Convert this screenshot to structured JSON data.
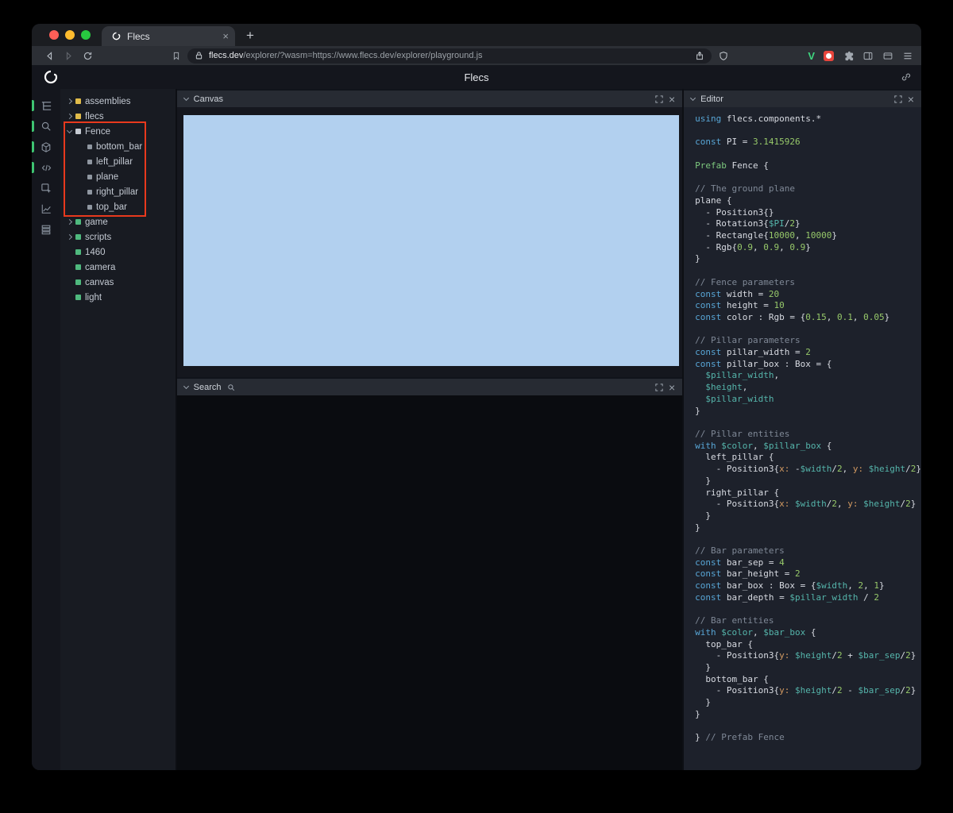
{
  "browser": {
    "tab_title": "Flecs",
    "close_tab_label": "×",
    "new_tab_label": "+",
    "url_host": "flecs.dev",
    "url_path": "/explorer/?wasm=https://www.flecs.dev/explorer/playground.js",
    "traffic_lights": [
      "#ff5f57",
      "#febc2e",
      "#28c840"
    ],
    "extension_v_label": "V"
  },
  "header": {
    "title": "Flecs"
  },
  "sidebar_icons": [
    {
      "name": "entity-tree",
      "active": true
    },
    {
      "name": "search",
      "active": true
    },
    {
      "name": "entities",
      "active": true
    },
    {
      "name": "code",
      "active": true
    },
    {
      "name": "inspector",
      "active": false
    },
    {
      "name": "stats",
      "active": false
    },
    {
      "name": "queries",
      "active": false
    }
  ],
  "tree": {
    "items": [
      {
        "label": "assemblies",
        "chevron": "collapsed",
        "square": "#e0bb4a",
        "depth": 0
      },
      {
        "label": "flecs",
        "chevron": "collapsed",
        "square": "#e0bb4a",
        "depth": 0
      },
      {
        "label": "Fence",
        "chevron": "expanded",
        "square": "#c6cbd3",
        "depth": 0
      },
      {
        "label": "bottom_bar",
        "chevron": "none",
        "square": "#8f97a1",
        "depth": 1
      },
      {
        "label": "left_pillar",
        "chevron": "none",
        "square": "#8f97a1",
        "depth": 1
      },
      {
        "label": "plane",
        "chevron": "none",
        "square": "#8f97a1",
        "depth": 1
      },
      {
        "label": "right_pillar",
        "chevron": "none",
        "square": "#8f97a1",
        "depth": 1
      },
      {
        "label": "top_bar",
        "chevron": "none",
        "square": "#8f97a1",
        "depth": 1
      },
      {
        "label": "game",
        "chevron": "collapsed",
        "square": "#4fb97e",
        "depth": 0
      },
      {
        "label": "scripts",
        "chevron": "collapsed",
        "square": "#4fb97e",
        "depth": 0
      },
      {
        "label": "1460",
        "chevron": "none",
        "square": "#4fb97e",
        "depth": 0
      },
      {
        "label": "camera",
        "chevron": "none",
        "square": "#4fb97e",
        "depth": 0
      },
      {
        "label": "canvas",
        "chevron": "none",
        "square": "#4fb97e",
        "depth": 0
      },
      {
        "label": "light",
        "chevron": "none",
        "square": "#4fb97e",
        "depth": 0
      }
    ],
    "annotation_color": "#e8391d"
  },
  "panels": {
    "canvas": {
      "title": "Canvas",
      "canvas_color": "#b2d0ef"
    },
    "search": {
      "title": "Search"
    },
    "editor": {
      "title": "Editor"
    }
  },
  "code": {
    "lines": [
      [
        [
          "k",
          "using"
        ],
        [
          "p",
          " flecs.components.*"
        ]
      ],
      [],
      [
        [
          "k",
          "const"
        ],
        [
          "p",
          " PI = "
        ],
        [
          "n",
          "3.1415926"
        ]
      ],
      [],
      [
        [
          "k2",
          "Prefab"
        ],
        [
          "p",
          " Fence {"
        ]
      ],
      [],
      [
        [
          "c",
          "// The ground plane"
        ]
      ],
      [
        [
          "p",
          "plane {"
        ]
      ],
      [
        [
          "p",
          "  - Position3{}"
        ]
      ],
      [
        [
          "p",
          "  - Rotation3{"
        ],
        [
          "v",
          "$PI"
        ],
        [
          "p",
          "/"
        ],
        [
          "n",
          "2"
        ],
        [
          "p",
          "}"
        ]
      ],
      [
        [
          "p",
          "  - Rectangle{"
        ],
        [
          "n",
          "10000"
        ],
        [
          "p",
          ", "
        ],
        [
          "n",
          "10000"
        ],
        [
          "p",
          "}"
        ]
      ],
      [
        [
          "p",
          "  - Rgb{"
        ],
        [
          "n",
          "0.9"
        ],
        [
          "p",
          ", "
        ],
        [
          "n",
          "0.9"
        ],
        [
          "p",
          ", "
        ],
        [
          "n",
          "0.9"
        ],
        [
          "p",
          "}"
        ]
      ],
      [
        [
          "p",
          "}"
        ]
      ],
      [],
      [
        [
          "c",
          "// Fence parameters"
        ]
      ],
      [
        [
          "k",
          "const"
        ],
        [
          "p",
          " width = "
        ],
        [
          "n",
          "20"
        ]
      ],
      [
        [
          "k",
          "const"
        ],
        [
          "p",
          " height = "
        ],
        [
          "n",
          "10"
        ]
      ],
      [
        [
          "k",
          "const"
        ],
        [
          "p",
          " color : Rgb = {"
        ],
        [
          "n",
          "0.15"
        ],
        [
          "p",
          ", "
        ],
        [
          "n",
          "0.1"
        ],
        [
          "p",
          ", "
        ],
        [
          "n",
          "0.05"
        ],
        [
          "p",
          "}"
        ]
      ],
      [],
      [
        [
          "c",
          "// Pillar parameters"
        ]
      ],
      [
        [
          "k",
          "const"
        ],
        [
          "p",
          " pillar_width = "
        ],
        [
          "n",
          "2"
        ]
      ],
      [
        [
          "k",
          "const"
        ],
        [
          "p",
          " pillar_box : Box = {"
        ]
      ],
      [
        [
          "p",
          "  "
        ],
        [
          "v",
          "$pillar_width"
        ],
        [
          "p",
          ","
        ]
      ],
      [
        [
          "p",
          "  "
        ],
        [
          "v",
          "$height"
        ],
        [
          "p",
          ","
        ]
      ],
      [
        [
          "p",
          "  "
        ],
        [
          "v",
          "$pillar_width"
        ]
      ],
      [
        [
          "p",
          "}"
        ]
      ],
      [],
      [
        [
          "c",
          "// Pillar entities"
        ]
      ],
      [
        [
          "k",
          "with"
        ],
        [
          "p",
          " "
        ],
        [
          "v",
          "$color"
        ],
        [
          "p",
          ", "
        ],
        [
          "v",
          "$pillar_box"
        ],
        [
          "p",
          " {"
        ]
      ],
      [
        [
          "p",
          "  left_pillar {"
        ]
      ],
      [
        [
          "p",
          "    - Position3{"
        ],
        [
          "o",
          "x:"
        ],
        [
          "p",
          " -"
        ],
        [
          "v",
          "$width"
        ],
        [
          "p",
          "/"
        ],
        [
          "n",
          "2"
        ],
        [
          "p",
          ", "
        ],
        [
          "o",
          "y:"
        ],
        [
          "p",
          " "
        ],
        [
          "v",
          "$height"
        ],
        [
          "p",
          "/"
        ],
        [
          "n",
          "2"
        ],
        [
          "p",
          "}"
        ]
      ],
      [
        [
          "p",
          "  }"
        ]
      ],
      [
        [
          "p",
          "  right_pillar {"
        ]
      ],
      [
        [
          "p",
          "    - Position3{"
        ],
        [
          "o",
          "x:"
        ],
        [
          "p",
          " "
        ],
        [
          "v",
          "$width"
        ],
        [
          "p",
          "/"
        ],
        [
          "n",
          "2"
        ],
        [
          "p",
          ", "
        ],
        [
          "o",
          "y:"
        ],
        [
          "p",
          " "
        ],
        [
          "v",
          "$height"
        ],
        [
          "p",
          "/"
        ],
        [
          "n",
          "2"
        ],
        [
          "p",
          "}"
        ]
      ],
      [
        [
          "p",
          "  }"
        ]
      ],
      [
        [
          "p",
          "}"
        ]
      ],
      [],
      [
        [
          "c",
          "// Bar parameters"
        ]
      ],
      [
        [
          "k",
          "const"
        ],
        [
          "p",
          " bar_sep = "
        ],
        [
          "n",
          "4"
        ]
      ],
      [
        [
          "k",
          "const"
        ],
        [
          "p",
          " bar_height = "
        ],
        [
          "n",
          "2"
        ]
      ],
      [
        [
          "k",
          "const"
        ],
        [
          "p",
          " bar_box : Box = {"
        ],
        [
          "v",
          "$width"
        ],
        [
          "p",
          ", "
        ],
        [
          "n",
          "2"
        ],
        [
          "p",
          ", "
        ],
        [
          "n",
          "1"
        ],
        [
          "p",
          "}"
        ]
      ],
      [
        [
          "k",
          "const"
        ],
        [
          "p",
          " bar_depth = "
        ],
        [
          "v",
          "$pillar_width"
        ],
        [
          "p",
          " / "
        ],
        [
          "n",
          "2"
        ]
      ],
      [],
      [
        [
          "c",
          "// Bar entities"
        ]
      ],
      [
        [
          "k",
          "with"
        ],
        [
          "p",
          " "
        ],
        [
          "v",
          "$color"
        ],
        [
          "p",
          ", "
        ],
        [
          "v",
          "$bar_box"
        ],
        [
          "p",
          " {"
        ]
      ],
      [
        [
          "p",
          "  top_bar {"
        ]
      ],
      [
        [
          "p",
          "    - Position3{"
        ],
        [
          "o",
          "y:"
        ],
        [
          "p",
          " "
        ],
        [
          "v",
          "$height"
        ],
        [
          "p",
          "/"
        ],
        [
          "n",
          "2"
        ],
        [
          "p",
          " + "
        ],
        [
          "v",
          "$bar_sep"
        ],
        [
          "p",
          "/"
        ],
        [
          "n",
          "2"
        ],
        [
          "p",
          "}"
        ]
      ],
      [
        [
          "p",
          "  }"
        ]
      ],
      [
        [
          "p",
          "  bottom_bar {"
        ]
      ],
      [
        [
          "p",
          "    - Position3{"
        ],
        [
          "o",
          "y:"
        ],
        [
          "p",
          " "
        ],
        [
          "v",
          "$height"
        ],
        [
          "p",
          "/"
        ],
        [
          "n",
          "2"
        ],
        [
          "p",
          " - "
        ],
        [
          "v",
          "$bar_sep"
        ],
        [
          "p",
          "/"
        ],
        [
          "n",
          "2"
        ],
        [
          "p",
          "}"
        ]
      ],
      [
        [
          "p",
          "  }"
        ]
      ],
      [
        [
          "p",
          "}"
        ]
      ],
      [],
      [
        [
          "p",
          "} "
        ],
        [
          "c",
          "// Prefab Fence"
        ]
      ]
    ]
  }
}
